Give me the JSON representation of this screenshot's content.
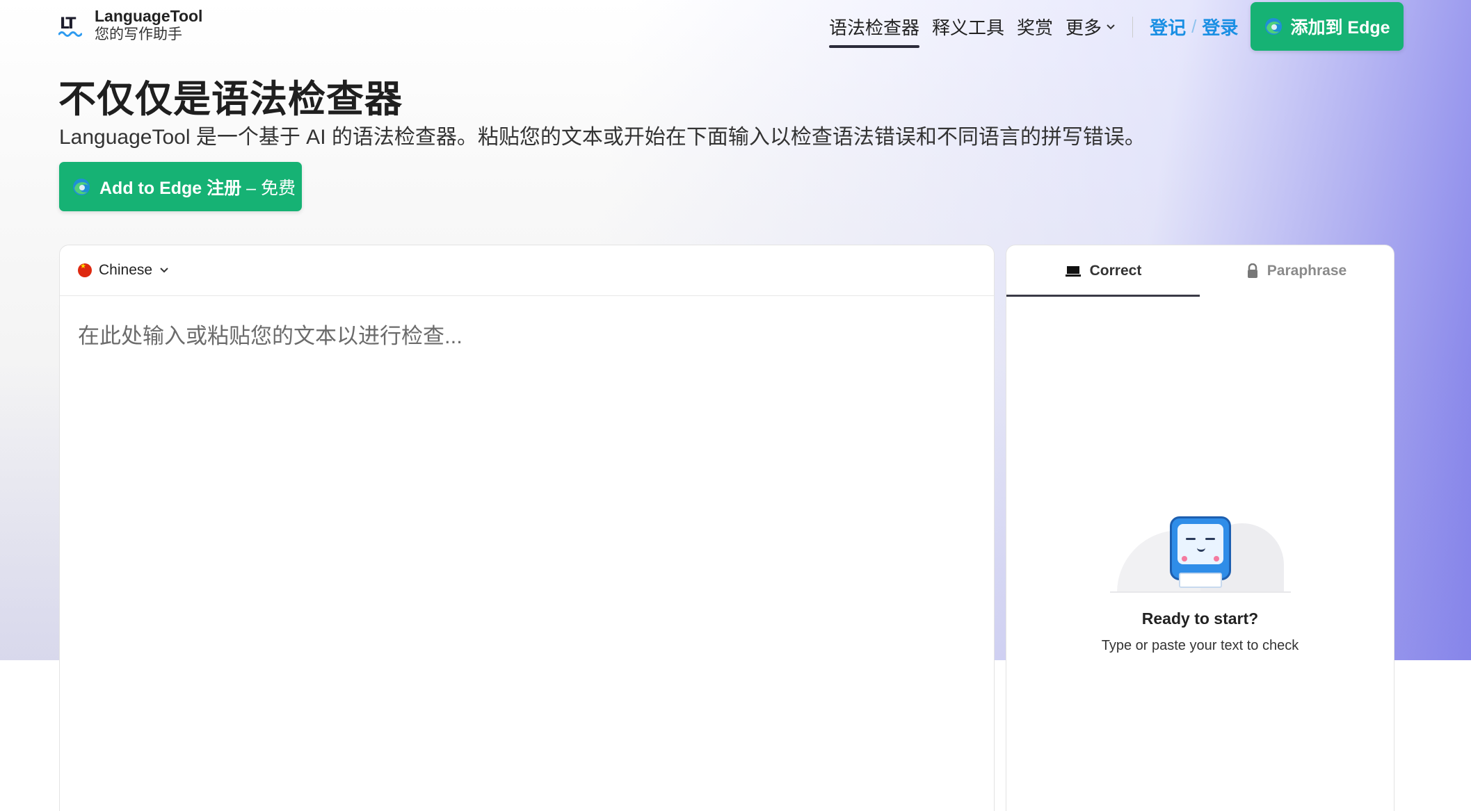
{
  "colors": {
    "primary_green": "#16b274",
    "link_blue": "#1a8fe3",
    "accent_purple": "#7876e8"
  },
  "header": {
    "logo_mark": "LT",
    "app_name": "LanguageTool",
    "tagline": "您的写作助手",
    "nav": [
      {
        "label": "语法检查器",
        "active": true
      },
      {
        "label": "释义工具",
        "active": false
      },
      {
        "label": "奖赏",
        "active": false
      },
      {
        "label": "更多",
        "active": false,
        "icon": "chevron-down-icon"
      }
    ],
    "register_label": "登记",
    "auth_separator": "/",
    "login_label": "登录",
    "add_edge_label": "添加到 Edge"
  },
  "hero": {
    "title": "不仅仅是语法检查器",
    "subtitle": "LanguageTool 是一个基于 AI 的语法检查器。粘贴您的文本或开始在下面输入以检查语法错误和不同语言的拼写错误。",
    "cta_main": "Add to Edge 注册",
    "cta_free": " – 免费"
  },
  "editor": {
    "language": "Chinese",
    "language_icon": "china-flag-icon",
    "placeholder": "在此处输入或粘贴您的文本以进行检查..."
  },
  "side_panel": {
    "tabs": [
      {
        "label": "Correct",
        "icon": "laptop-icon",
        "active": true
      },
      {
        "label": "Paraphrase",
        "icon": "lock-icon",
        "active": false
      }
    ],
    "ready_title": "Ready to start?",
    "ready_subtitle": "Type or paste your text to check"
  }
}
